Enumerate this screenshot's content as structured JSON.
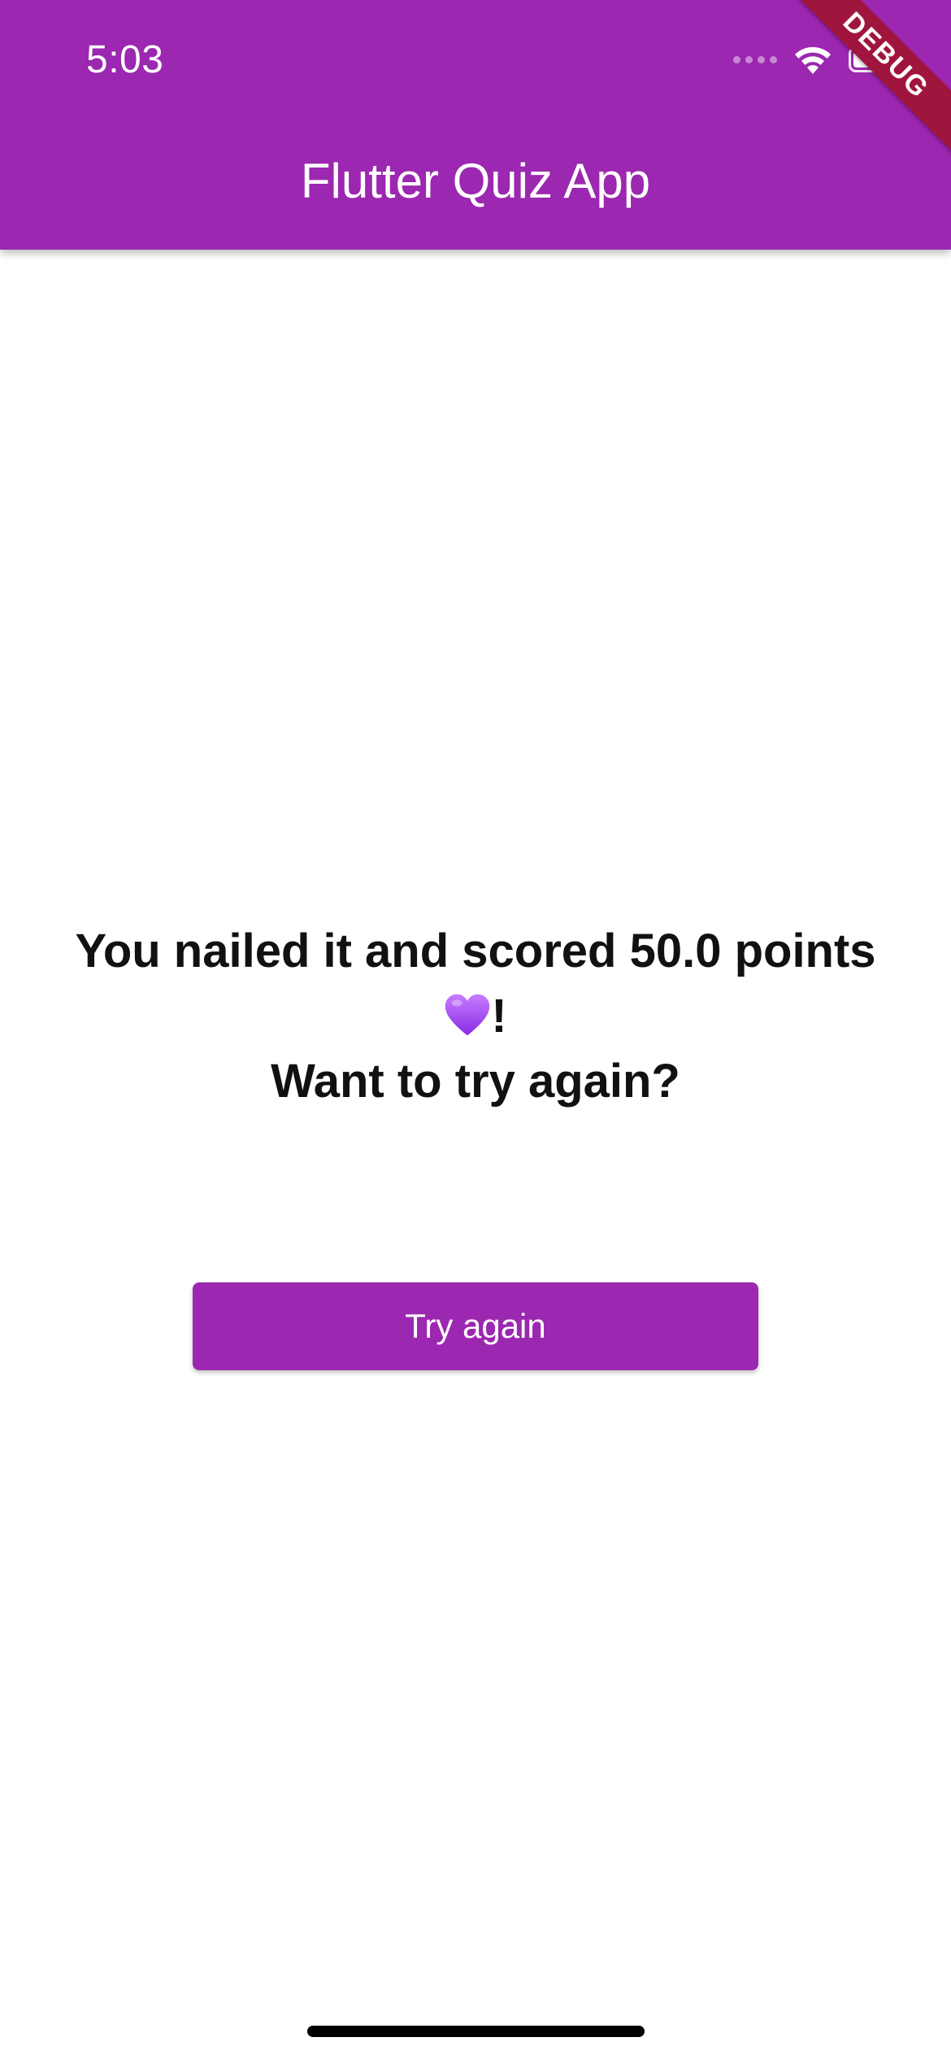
{
  "status_bar": {
    "time": "5:03",
    "icons": [
      "signal-dots-icon",
      "wifi-icon",
      "battery-icon"
    ]
  },
  "app_bar": {
    "title": "Flutter Quiz App",
    "color": "#9c27b0"
  },
  "debug_banner": {
    "label": "DEBUG",
    "color": "#a0153e"
  },
  "result": {
    "line1": "You nailed it and scored 50.0 points",
    "heart_icon": "purple-heart-icon",
    "exclamation": "!",
    "line3": "Want to try again?"
  },
  "actions": {
    "try_again_label": "Try again"
  }
}
